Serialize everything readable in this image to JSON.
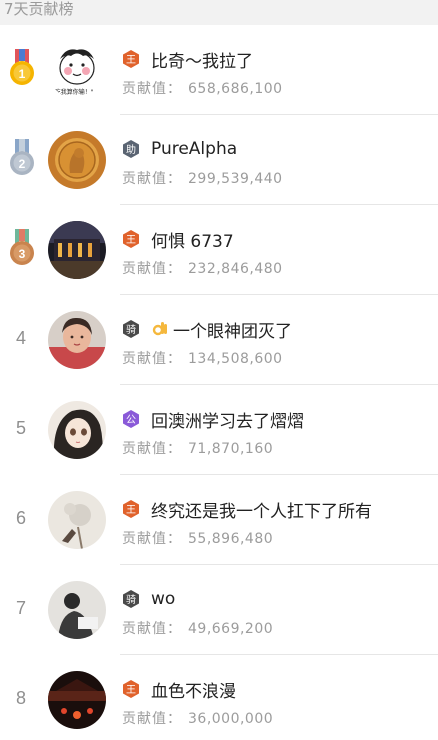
{
  "header": {
    "title": "7天贡献榜"
  },
  "contribution_label": "贡献值：",
  "rows": [
    {
      "rank": "1",
      "name": "比奇～我拉了",
      "value": "658,686,100",
      "badge": "王"
    },
    {
      "rank": "2",
      "name": "PureAlpha",
      "value": "299,539,440",
      "badge": "助"
    },
    {
      "rank": "3",
      "name": "何惧 6737",
      "value": "232,846,480",
      "badge": "王"
    },
    {
      "rank": "4",
      "name": "一个眼神团灭了",
      "value": "134,508,600",
      "badge": "骑"
    },
    {
      "rank": "5",
      "name": "回澳洲学习去了熠熠",
      "value": "71,870,160",
      "badge": "公"
    },
    {
      "rank": "6",
      "name": "终究还是我一个人扛下了所有",
      "value": "55,896,480",
      "badge": "王"
    },
    {
      "rank": "7",
      "name": "wo",
      "value": "49,669,200",
      "badge": "骑"
    },
    {
      "rank": "8",
      "name": "血色不浪漫",
      "value": "36,000,000",
      "badge": "王"
    }
  ],
  "avatar_1_caption": "\"吃我算你输！\"",
  "colors": {
    "gold": "#f5b400",
    "silver": "#a9b4c2",
    "bronze": "#c9844e",
    "badge_king": "#e0622c",
    "badge_helper": "#5a6472",
    "badge_knight": "#4a4a4a",
    "badge_duke": "#8a5ad8"
  }
}
